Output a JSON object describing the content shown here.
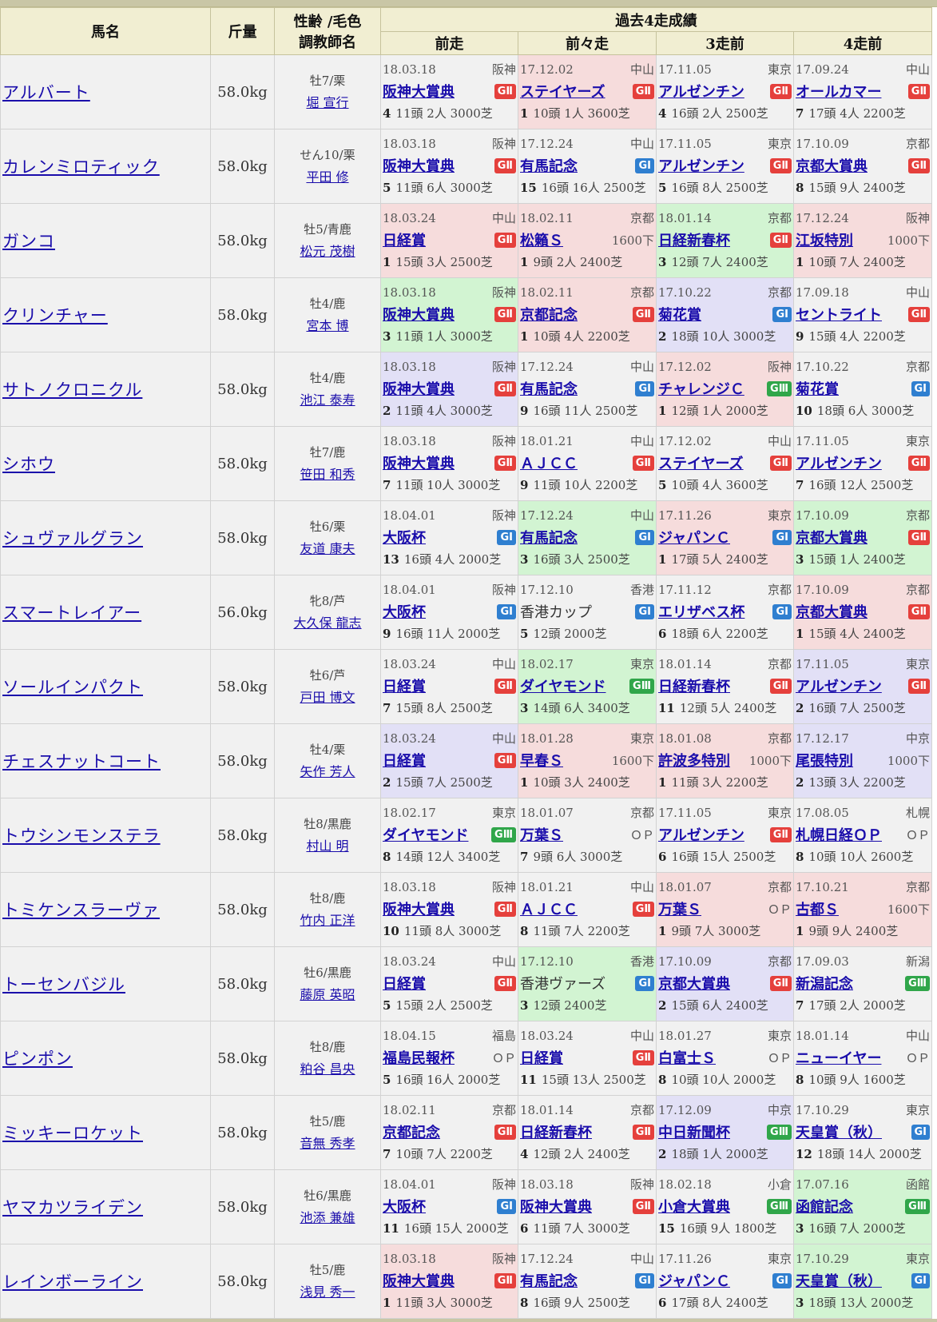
{
  "header": {
    "horse": "馬名",
    "weight": "斤量",
    "info_line1": "性齢 /毛色",
    "info_line2": "調教師名",
    "past": "過去4走成績",
    "r1": "前走",
    "r2": "前々走",
    "r3": "3走前",
    "r4": "4走前"
  },
  "colors": {
    "G1": "#2f7fd0",
    "G2": "#e5403c",
    "G3": "#30a64a",
    "pink": "#f6dcdc",
    "green": "#d2f4d2",
    "purple": "#e2e0f6"
  },
  "horses": [
    {
      "name": "アルバート",
      "weight": "58.0kg",
      "sexage": "牡7/栗",
      "trainer": "堀 宣行",
      "races": [
        {
          "date": "18.03.18",
          "venue": "阪神",
          "race": "阪神大賞典",
          "grade": "GⅡ",
          "gcls": "g2",
          "result": "4",
          "detail": "11頭 2人 3000芝",
          "color": ""
        },
        {
          "date": "17.12.02",
          "venue": "中山",
          "race": "ステイヤーズ",
          "grade": "GⅡ",
          "gcls": "g2",
          "result": "1",
          "detail": "10頭 1人 3600芝",
          "color": "pink"
        },
        {
          "date": "17.11.05",
          "venue": "東京",
          "race": "アルゼンチン",
          "grade": "GⅡ",
          "gcls": "g2",
          "result": "4",
          "detail": "16頭 2人 2500芝",
          "color": ""
        },
        {
          "date": "17.09.24",
          "venue": "中山",
          "race": "オールカマー",
          "grade": "GⅡ",
          "gcls": "g2",
          "result": "7",
          "detail": "17頭 4人 2200芝",
          "color": ""
        }
      ]
    },
    {
      "name": "カレンミロティック",
      "weight": "58.0kg",
      "sexage": "せん10/栗",
      "trainer": "平田 修",
      "races": [
        {
          "date": "18.03.18",
          "venue": "阪神",
          "race": "阪神大賞典",
          "grade": "GⅡ",
          "gcls": "g2",
          "result": "5",
          "detail": "11頭 6人 3000芝",
          "color": ""
        },
        {
          "date": "17.12.24",
          "venue": "中山",
          "race": "有馬記念",
          "grade": "GⅠ",
          "gcls": "g1",
          "result": "15",
          "detail": "16頭 16人 2500芝",
          "color": ""
        },
        {
          "date": "17.11.05",
          "venue": "東京",
          "race": "アルゼンチン",
          "grade": "GⅡ",
          "gcls": "g2",
          "result": "5",
          "detail": "16頭 8人 2500芝",
          "color": ""
        },
        {
          "date": "17.10.09",
          "venue": "京都",
          "race": "京都大賞典",
          "grade": "GⅡ",
          "gcls": "g2",
          "result": "8",
          "detail": "15頭 9人 2400芝",
          "color": ""
        }
      ]
    },
    {
      "name": "ガンコ",
      "weight": "58.0kg",
      "sexage": "牡5/青鹿",
      "trainer": "松元 茂樹",
      "races": [
        {
          "date": "18.03.24",
          "venue": "中山",
          "race": "日経賞",
          "grade": "GⅡ",
          "gcls": "g2",
          "result": "1",
          "detail": "15頭 3人 2500芝",
          "color": "pink"
        },
        {
          "date": "18.02.11",
          "venue": "京都",
          "race": "松籟Ｓ",
          "grade": "1600下",
          "gcls": "txt",
          "result": "1",
          "detail": "9頭 2人 2400芝",
          "color": "pink"
        },
        {
          "date": "18.01.14",
          "venue": "京都",
          "race": "日経新春杯",
          "grade": "GⅡ",
          "gcls": "g2",
          "result": "3",
          "detail": "12頭 7人 2400芝",
          "color": "green"
        },
        {
          "date": "17.12.24",
          "venue": "阪神",
          "race": "江坂特別",
          "grade": "1000下",
          "gcls": "txt",
          "result": "1",
          "detail": "10頭 7人 2400芝",
          "color": "pink"
        }
      ]
    },
    {
      "name": "クリンチャー",
      "weight": "58.0kg",
      "sexage": "牡4/鹿",
      "trainer": "宮本 博",
      "races": [
        {
          "date": "18.03.18",
          "venue": "阪神",
          "race": "阪神大賞典",
          "grade": "GⅡ",
          "gcls": "g2",
          "result": "3",
          "detail": "11頭 1人 3000芝",
          "color": "green"
        },
        {
          "date": "18.02.11",
          "venue": "京都",
          "race": "京都記念",
          "grade": "GⅡ",
          "gcls": "g2",
          "result": "1",
          "detail": "10頭 4人 2200芝",
          "color": "pink"
        },
        {
          "date": "17.10.22",
          "venue": "京都",
          "race": "菊花賞",
          "grade": "GⅠ",
          "gcls": "g1",
          "result": "2",
          "detail": "18頭 10人 3000芝",
          "color": "purple"
        },
        {
          "date": "17.09.18",
          "venue": "中山",
          "race": "セントライト",
          "grade": "GⅡ",
          "gcls": "g2",
          "result": "9",
          "detail": "15頭 4人 2200芝",
          "color": ""
        }
      ]
    },
    {
      "name": "サトノクロニクル",
      "weight": "58.0kg",
      "sexage": "牡4/鹿",
      "trainer": "池江 泰寿",
      "races": [
        {
          "date": "18.03.18",
          "venue": "阪神",
          "race": "阪神大賞典",
          "grade": "GⅡ",
          "gcls": "g2",
          "result": "2",
          "detail": "11頭 4人 3000芝",
          "color": "purple"
        },
        {
          "date": "17.12.24",
          "venue": "中山",
          "race": "有馬記念",
          "grade": "GⅠ",
          "gcls": "g1",
          "result": "9",
          "detail": "16頭 11人 2500芝",
          "color": ""
        },
        {
          "date": "17.12.02",
          "venue": "阪神",
          "race": "チャレンジＣ",
          "grade": "GⅢ",
          "gcls": "g3",
          "result": "1",
          "detail": "12頭 1人 2000芝",
          "color": "pink"
        },
        {
          "date": "17.10.22",
          "venue": "京都",
          "race": "菊花賞",
          "grade": "GⅠ",
          "gcls": "g1",
          "result": "10",
          "detail": "18頭 6人 3000芝",
          "color": ""
        }
      ]
    },
    {
      "name": "シホウ",
      "weight": "58.0kg",
      "sexage": "牡7/鹿",
      "trainer": "笹田 和秀",
      "races": [
        {
          "date": "18.03.18",
          "venue": "阪神",
          "race": "阪神大賞典",
          "grade": "GⅡ",
          "gcls": "g2",
          "result": "7",
          "detail": "11頭 10人 3000芝",
          "color": ""
        },
        {
          "date": "18.01.21",
          "venue": "中山",
          "race": "ＡＪＣＣ",
          "grade": "GⅡ",
          "gcls": "g2",
          "result": "9",
          "detail": "11頭 10人 2200芝",
          "color": ""
        },
        {
          "date": "17.12.02",
          "venue": "中山",
          "race": "ステイヤーズ",
          "grade": "GⅡ",
          "gcls": "g2",
          "result": "5",
          "detail": "10頭 4人 3600芝",
          "color": ""
        },
        {
          "date": "17.11.05",
          "venue": "東京",
          "race": "アルゼンチン",
          "grade": "GⅡ",
          "gcls": "g2",
          "result": "7",
          "detail": "16頭 12人 2500芝",
          "color": ""
        }
      ]
    },
    {
      "name": "シュヴァルグラン",
      "weight": "58.0kg",
      "sexage": "牡6/栗",
      "trainer": "友道 康夫",
      "races": [
        {
          "date": "18.04.01",
          "venue": "阪神",
          "race": "大阪杯",
          "grade": "GⅠ",
          "gcls": "g1",
          "result": "13",
          "detail": "16頭 4人 2000芝",
          "color": ""
        },
        {
          "date": "17.12.24",
          "venue": "中山",
          "race": "有馬記念",
          "grade": "GⅠ",
          "gcls": "g1",
          "result": "3",
          "detail": "16頭 3人 2500芝",
          "color": "green"
        },
        {
          "date": "17.11.26",
          "venue": "東京",
          "race": "ジャパンＣ",
          "grade": "GⅠ",
          "gcls": "g1",
          "result": "1",
          "detail": "17頭 5人 2400芝",
          "color": "pink"
        },
        {
          "date": "17.10.09",
          "venue": "京都",
          "race": "京都大賞典",
          "grade": "GⅡ",
          "gcls": "g2",
          "result": "3",
          "detail": "15頭 1人 2400芝",
          "color": "green"
        }
      ]
    },
    {
      "name": "スマートレイアー",
      "weight": "56.0kg",
      "sexage": "牝8/芦",
      "trainer": "大久保 龍志",
      "races": [
        {
          "date": "18.04.01",
          "venue": "阪神",
          "race": "大阪杯",
          "grade": "GⅠ",
          "gcls": "g1",
          "result": "9",
          "detail": "16頭 11人 2000芝",
          "color": ""
        },
        {
          "date": "17.12.10",
          "venue": "香港",
          "race": "香港カップ",
          "grade": "GⅠ",
          "gcls": "g1",
          "result": "5",
          "detail": "12頭 2000芝",
          "color": "",
          "plain": true
        },
        {
          "date": "17.11.12",
          "venue": "京都",
          "race": "エリザベス杯",
          "grade": "GⅠ",
          "gcls": "g1",
          "result": "6",
          "detail": "18頭 6人 2200芝",
          "color": ""
        },
        {
          "date": "17.10.09",
          "venue": "京都",
          "race": "京都大賞典",
          "grade": "GⅡ",
          "gcls": "g2",
          "result": "1",
          "detail": "15頭 4人 2400芝",
          "color": "pink"
        }
      ]
    },
    {
      "name": "ソールインパクト",
      "weight": "58.0kg",
      "sexage": "牡6/芦",
      "trainer": "戸田 博文",
      "races": [
        {
          "date": "18.03.24",
          "venue": "中山",
          "race": "日経賞",
          "grade": "GⅡ",
          "gcls": "g2",
          "result": "7",
          "detail": "15頭 8人 2500芝",
          "color": ""
        },
        {
          "date": "18.02.17",
          "venue": "東京",
          "race": "ダイヤモンド",
          "grade": "GⅢ",
          "gcls": "g3",
          "result": "3",
          "detail": "14頭 6人 3400芝",
          "color": "green"
        },
        {
          "date": "18.01.14",
          "venue": "京都",
          "race": "日経新春杯",
          "grade": "GⅡ",
          "gcls": "g2",
          "result": "11",
          "detail": "12頭 5人 2400芝",
          "color": ""
        },
        {
          "date": "17.11.05",
          "venue": "東京",
          "race": "アルゼンチン",
          "grade": "GⅡ",
          "gcls": "g2",
          "result": "2",
          "detail": "16頭 7人 2500芝",
          "color": "purple"
        }
      ]
    },
    {
      "name": "チェスナットコート",
      "weight": "58.0kg",
      "sexage": "牡4/栗",
      "trainer": "矢作 芳人",
      "races": [
        {
          "date": "18.03.24",
          "venue": "中山",
          "race": "日経賞",
          "grade": "GⅡ",
          "gcls": "g2",
          "result": "2",
          "detail": "15頭 7人 2500芝",
          "color": "purple"
        },
        {
          "date": "18.01.28",
          "venue": "東京",
          "race": "早春Ｓ",
          "grade": "1600下",
          "gcls": "txt",
          "result": "1",
          "detail": "10頭 3人 2400芝",
          "color": "pink"
        },
        {
          "date": "18.01.08",
          "venue": "京都",
          "race": "許波多特別",
          "grade": "1000下",
          "gcls": "txt",
          "result": "1",
          "detail": "11頭 3人 2200芝",
          "color": "pink"
        },
        {
          "date": "17.12.17",
          "venue": "中京",
          "race": "尾張特別",
          "grade": "1000下",
          "gcls": "txt",
          "result": "2",
          "detail": "13頭 3人 2200芝",
          "color": "purple"
        }
      ]
    },
    {
      "name": "トウシンモンステラ",
      "weight": "58.0kg",
      "sexage": "牡8/黒鹿",
      "trainer": "村山 明",
      "races": [
        {
          "date": "18.02.17",
          "venue": "東京",
          "race": "ダイヤモンド",
          "grade": "GⅢ",
          "gcls": "g3",
          "result": "8",
          "detail": "14頭 12人 3400芝",
          "color": ""
        },
        {
          "date": "18.01.07",
          "venue": "京都",
          "race": "万葉Ｓ",
          "grade": "ＯＰ",
          "gcls": "txt",
          "result": "7",
          "detail": "9頭 6人 3000芝",
          "color": ""
        },
        {
          "date": "17.11.05",
          "venue": "東京",
          "race": "アルゼンチン",
          "grade": "GⅡ",
          "gcls": "g2",
          "result": "6",
          "detail": "16頭 15人 2500芝",
          "color": ""
        },
        {
          "date": "17.08.05",
          "venue": "札幌",
          "race": "札幌日経ＯＰ",
          "grade": "ＯＰ",
          "gcls": "txt",
          "result": "8",
          "detail": "10頭 10人 2600芝",
          "color": ""
        }
      ]
    },
    {
      "name": "トミケンスラーヴァ",
      "weight": "58.0kg",
      "sexage": "牡8/鹿",
      "trainer": "竹内 正洋",
      "races": [
        {
          "date": "18.03.18",
          "venue": "阪神",
          "race": "阪神大賞典",
          "grade": "GⅡ",
          "gcls": "g2",
          "result": "10",
          "detail": "11頭 8人 3000芝",
          "color": ""
        },
        {
          "date": "18.01.21",
          "venue": "中山",
          "race": "ＡＪＣＣ",
          "grade": "GⅡ",
          "gcls": "g2",
          "result": "8",
          "detail": "11頭 7人 2200芝",
          "color": ""
        },
        {
          "date": "18.01.07",
          "venue": "京都",
          "race": "万葉Ｓ",
          "grade": "ＯＰ",
          "gcls": "txt",
          "result": "1",
          "detail": "9頭 7人 3000芝",
          "color": "pink"
        },
        {
          "date": "17.10.21",
          "venue": "京都",
          "race": "古都Ｓ",
          "grade": "1600下",
          "gcls": "txt",
          "result": "1",
          "detail": "9頭 9人 2400芝",
          "color": "pink"
        }
      ]
    },
    {
      "name": "トーセンバジル",
      "weight": "58.0kg",
      "sexage": "牡6/黒鹿",
      "trainer": "藤原 英昭",
      "races": [
        {
          "date": "18.03.24",
          "venue": "中山",
          "race": "日経賞",
          "grade": "GⅡ",
          "gcls": "g2",
          "result": "5",
          "detail": "15頭 2人 2500芝",
          "color": ""
        },
        {
          "date": "17.12.10",
          "venue": "香港",
          "race": "香港ヴァーズ",
          "grade": "GⅠ",
          "gcls": "g1",
          "result": "3",
          "detail": "12頭 2400芝",
          "color": "green",
          "plain": true
        },
        {
          "date": "17.10.09",
          "venue": "京都",
          "race": "京都大賞典",
          "grade": "GⅡ",
          "gcls": "g2",
          "result": "2",
          "detail": "15頭 6人 2400芝",
          "color": "purple"
        },
        {
          "date": "17.09.03",
          "venue": "新潟",
          "race": "新潟記念",
          "grade": "GⅢ",
          "gcls": "g3",
          "result": "7",
          "detail": "17頭 2人 2000芝",
          "color": ""
        }
      ]
    },
    {
      "name": "ピンポン",
      "weight": "58.0kg",
      "sexage": "牡8/鹿",
      "trainer": "粕谷 昌央",
      "races": [
        {
          "date": "18.04.15",
          "venue": "福島",
          "race": "福島民報杯",
          "grade": "ＯＰ",
          "gcls": "txt",
          "result": "5",
          "detail": "16頭 16人 2000芝",
          "color": ""
        },
        {
          "date": "18.03.24",
          "venue": "中山",
          "race": "日経賞",
          "grade": "GⅡ",
          "gcls": "g2",
          "result": "11",
          "detail": "15頭 13人 2500芝",
          "color": ""
        },
        {
          "date": "18.01.27",
          "venue": "東京",
          "race": "白富士Ｓ",
          "grade": "ＯＰ",
          "gcls": "txt",
          "result": "8",
          "detail": "10頭 10人 2000芝",
          "color": ""
        },
        {
          "date": "18.01.14",
          "venue": "中山",
          "race": "ニューイヤー",
          "grade": "ＯＰ",
          "gcls": "txt",
          "result": "8",
          "detail": "10頭 9人 1600芝",
          "color": ""
        }
      ]
    },
    {
      "name": "ミッキーロケット",
      "weight": "58.0kg",
      "sexage": "牡5/鹿",
      "trainer": "音無 秀孝",
      "races": [
        {
          "date": "18.02.11",
          "venue": "京都",
          "race": "京都記念",
          "grade": "GⅡ",
          "gcls": "g2",
          "result": "7",
          "detail": "10頭 7人 2200芝",
          "color": ""
        },
        {
          "date": "18.01.14",
          "venue": "京都",
          "race": "日経新春杯",
          "grade": "GⅡ",
          "gcls": "g2",
          "result": "4",
          "detail": "12頭 2人 2400芝",
          "color": ""
        },
        {
          "date": "17.12.09",
          "venue": "中京",
          "race": "中日新聞杯",
          "grade": "GⅢ",
          "gcls": "g3",
          "result": "2",
          "detail": "18頭 1人 2000芝",
          "color": "purple"
        },
        {
          "date": "17.10.29",
          "venue": "東京",
          "race": "天皇賞（秋）",
          "grade": "GⅠ",
          "gcls": "g1",
          "result": "12",
          "detail": "18頭 14人 2000芝",
          "color": ""
        }
      ]
    },
    {
      "name": "ヤマカツライデン",
      "weight": "58.0kg",
      "sexage": "牡6/黒鹿",
      "trainer": "池添 兼雄",
      "races": [
        {
          "date": "18.04.01",
          "venue": "阪神",
          "race": "大阪杯",
          "grade": "GⅠ",
          "gcls": "g1",
          "result": "11",
          "detail": "16頭 15人 2000芝",
          "color": ""
        },
        {
          "date": "18.03.18",
          "venue": "阪神",
          "race": "阪神大賞典",
          "grade": "GⅡ",
          "gcls": "g2",
          "result": "6",
          "detail": "11頭 7人 3000芝",
          "color": ""
        },
        {
          "date": "18.02.18",
          "venue": "小倉",
          "race": "小倉大賞典",
          "grade": "GⅢ",
          "gcls": "g3",
          "result": "15",
          "detail": "16頭 9人 1800芝",
          "color": ""
        },
        {
          "date": "17.07.16",
          "venue": "函館",
          "race": "函館記念",
          "grade": "GⅢ",
          "gcls": "g3",
          "result": "3",
          "detail": "16頭 7人 2000芝",
          "color": "green"
        }
      ]
    },
    {
      "name": "レインボーライン",
      "weight": "58.0kg",
      "sexage": "牡5/鹿",
      "trainer": "浅見 秀一",
      "races": [
        {
          "date": "18.03.18",
          "venue": "阪神",
          "race": "阪神大賞典",
          "grade": "GⅡ",
          "gcls": "g2",
          "result": "1",
          "detail": "11頭 3人 3000芝",
          "color": "pink"
        },
        {
          "date": "17.12.24",
          "venue": "中山",
          "race": "有馬記念",
          "grade": "GⅠ",
          "gcls": "g1",
          "result": "8",
          "detail": "16頭 9人 2500芝",
          "color": ""
        },
        {
          "date": "17.11.26",
          "venue": "東京",
          "race": "ジャパンＣ",
          "grade": "GⅠ",
          "gcls": "g1",
          "result": "6",
          "detail": "17頭 8人 2400芝",
          "color": ""
        },
        {
          "date": "17.10.29",
          "venue": "東京",
          "race": "天皇賞（秋）",
          "grade": "GⅠ",
          "gcls": "g1",
          "result": "3",
          "detail": "18頭 13人 2000芝",
          "color": "green"
        }
      ]
    }
  ]
}
